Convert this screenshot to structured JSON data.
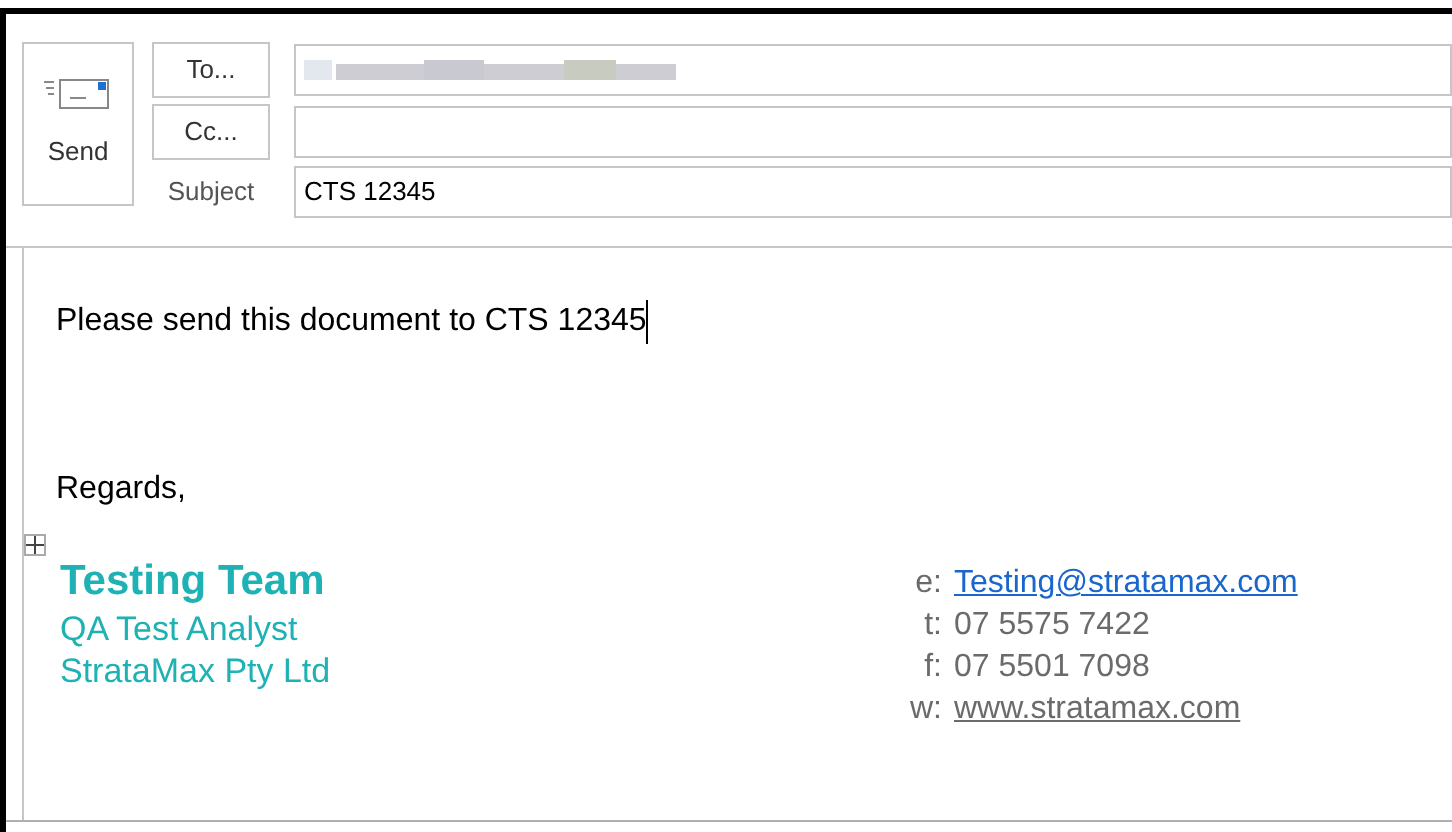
{
  "header": {
    "send_button": "Send",
    "to_button": "To...",
    "cc_button": "Cc...",
    "subject_label": "Subject",
    "subject_value": "CTS 12345",
    "to_blurred": true
  },
  "body": {
    "lines": [
      "Please send this document to CTS 12345",
      "Regards,"
    ],
    "caret_after_first_line": true
  },
  "signature": {
    "name": "Testing Team",
    "title": "QA Test Analyst",
    "company": "StrataMax Pty Ltd",
    "color": "#1fb2b4",
    "contacts": [
      {
        "label": "e:",
        "value": "Testing@stratamax.com",
        "kind": "email"
      },
      {
        "label": "t:",
        "value": "07 5575 7422",
        "kind": "phone"
      },
      {
        "label": "f:",
        "value": "07 5501 7098",
        "kind": "phone"
      },
      {
        "label": "w:",
        "value": "www.stratamax.com",
        "kind": "web"
      }
    ]
  }
}
